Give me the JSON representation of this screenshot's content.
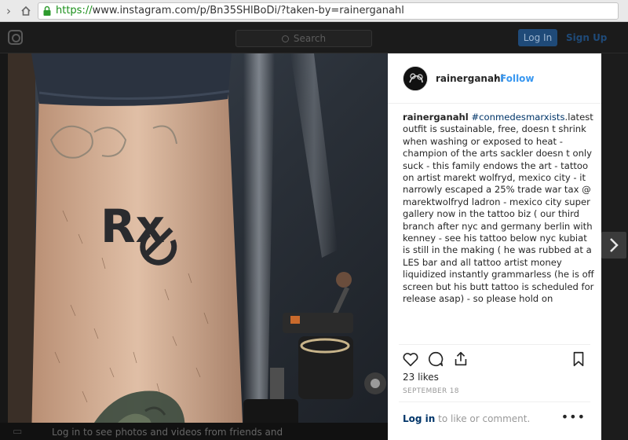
{
  "browser": {
    "url_scheme": "https://",
    "url_rest": "www.instagram.com/p/Bn35SHlBoDi/?taken-by=rainerganahl"
  },
  "header": {
    "search_placeholder": "Search",
    "login_label": "Log In",
    "signup_label": "Sign Up"
  },
  "post": {
    "username": "rainerganahl",
    "dot": "•",
    "follow_label": "Follow",
    "caption_user": "rainerganahl",
    "caption_tag": "#conmedesmarxists",
    "caption_text": ".latest outfit is sustainable, free, doesn t shrink when washing or exposed to heat - champion of the arts sackler doesn t only suck - this family endows the art - tattoo on artist marekt wolfryd, mexico city - it narrowly escaped a 25% trade war tax @ marektwolfryd ladron - mexico city super gallery now in the tattoo biz ( our third branch after nyc and germany berlin with kenney - see his tattoo below nyc kubiat is still in the making ( he was rubbed at a LES bar and all tattoo artist money liquidized instantly grammarless (he is off screen but his butt tattoo is scheduled for release asap) - so please hold on",
    "likes": "23 likes",
    "date": "SEPTEMBER 18",
    "comment_login": "Log in",
    "comment_rest": " to like or comment.",
    "more": "•••",
    "tattoo_text": "Rx"
  },
  "banner": {
    "text": "Log in to see photos and videos from friends and"
  },
  "colors": {
    "accent": "#3897f0",
    "link_dark": "#003569"
  }
}
